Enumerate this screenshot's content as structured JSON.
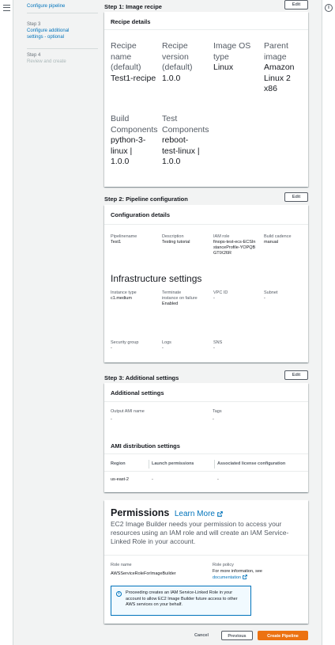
{
  "nav": {
    "configure_pipeline": "Configure pipeline",
    "step3_label": "Step 3",
    "step3_title": "Configure additional settings - optional",
    "step4_label": "Step 4",
    "step4_title": "Review and create"
  },
  "step1": {
    "heading": "Step 1: Image recipe",
    "edit": "Edit",
    "panel_title": "Recipe details",
    "recipe_name_label": "Recipe name (default)",
    "recipe_name_value": "Test1-recipe",
    "recipe_version_label": "Recipe version (default)",
    "recipe_version_value": "1.0.0",
    "os_type_label": "Image OS type",
    "os_type_value": "Linux",
    "parent_image_label": "Parent image",
    "parent_image_value": "Amazon Linux 2 x86",
    "build_components_label": "Build Components",
    "build_components_value": "python-3-linux | 1.0.0",
    "test_components_label": "Test Components",
    "test_components_value": "reboot-test-linux | 1.0.0"
  },
  "step2": {
    "heading": "Step 2: Pipeline configuration",
    "edit": "Edit",
    "panel_title": "Configuration details",
    "pipelinename_label": "Pipelinename",
    "pipelinename_value": "Test1",
    "description_label": "Description",
    "description_value": "Testing tutorial",
    "iam_role_label": "IAM role",
    "iam_role_value": "finops-test-ecs-ECSInstanceProfile-YOPQBGTIX26R",
    "build_cadence_label": "Build cadence",
    "build_cadence_value": "manual",
    "infra_title": "Infrastructure settings",
    "instance_type_label": "Instance type",
    "instance_type_value": "c1.medium",
    "terminate_label": "Terminate instance on failure",
    "terminate_value": "Enabled",
    "vpc_label": "VPC ID",
    "vpc_value": "-",
    "subnet_label": "Subnet",
    "subnet_value": "-",
    "sg_label": "Security group",
    "sg_value": "-",
    "logs_label": "Logs",
    "logs_value": "-",
    "sns_label": "SNS",
    "sns_value": "-"
  },
  "step3": {
    "heading": "Step 3: Additional settings",
    "edit": "Edit",
    "panel_title": "Additional settings",
    "output_ami_label": "Output AMI name",
    "output_ami_value": "-",
    "tags_label": "Tags",
    "tags_value": "-",
    "ami_dist_title": "AMI distribution settings",
    "col_region": "Region",
    "col_launch": "Launch permissions",
    "col_license": "Associated license configuration",
    "row_region": "us-east-2",
    "row_launch": "-",
    "row_license": "-"
  },
  "permissions": {
    "title": "Permissions",
    "learn_more": "Learn More",
    "description": "EC2 Image Builder needs your permission to access your resources using an IAM role and will create an IAM Service-Linked Role in your account.",
    "role_name_label": "Role name",
    "role_name_value": "AWSServiceRoleForImageBuilder",
    "role_policy_label": "Role policy",
    "role_policy_text": "For more information, see",
    "role_policy_link": "documentation",
    "info_text": "Proceeding creates an IAM Service-Linked Role in your account to allow EC2 Image Builder future access to other AWS services on your behalf."
  },
  "footer": {
    "cancel": "Cancel",
    "previous": "Previous",
    "create": "Create Pipeline"
  },
  "colors": {
    "link": "#0073bb",
    "primary": "#ec7211",
    "background": "#f2f3f3"
  },
  "icons": [
    "menu-icon",
    "info-icon",
    "external-link-icon"
  ]
}
